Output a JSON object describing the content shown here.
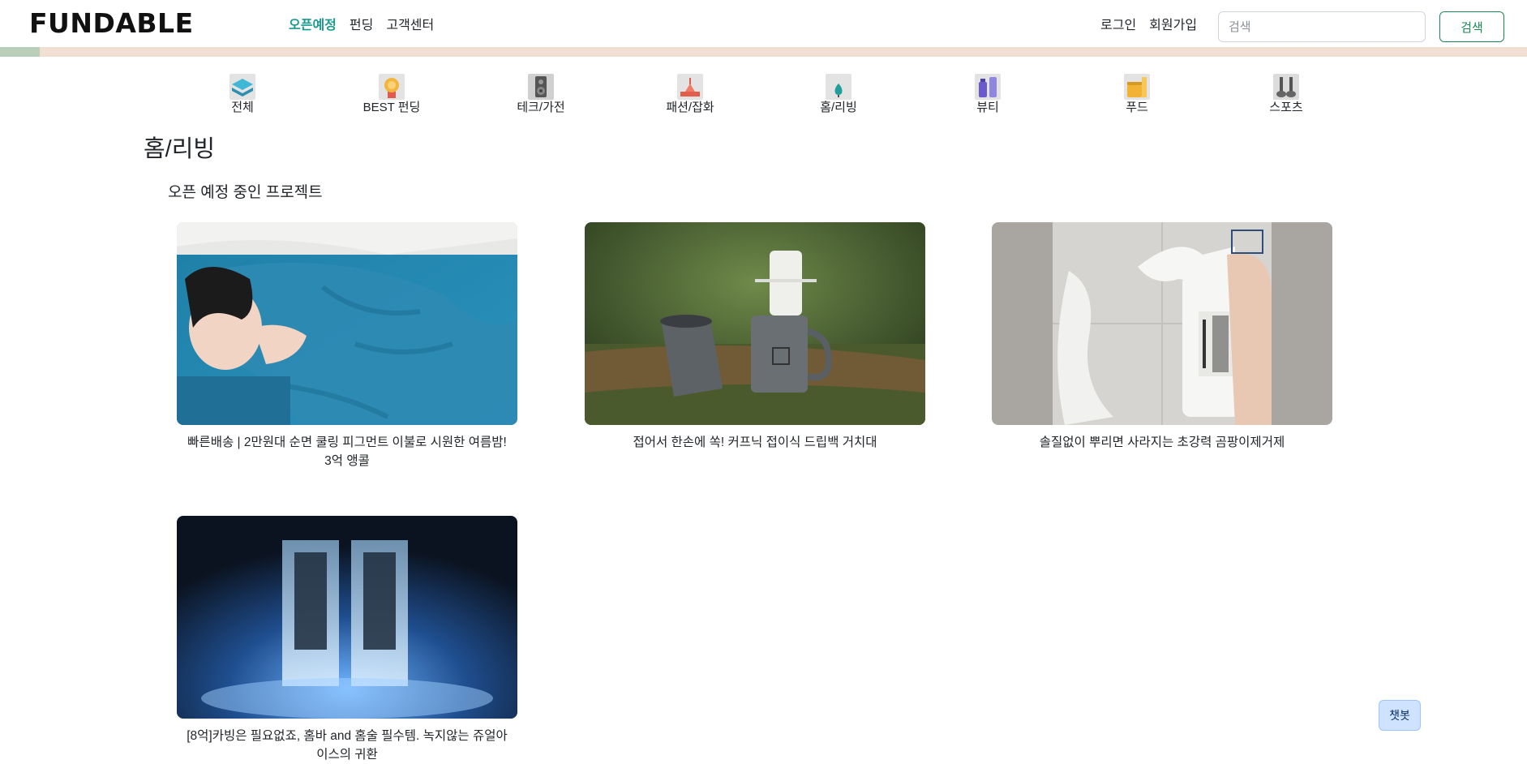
{
  "navbar": {
    "logo": "FUNDABLE",
    "links": [
      {
        "label": "오픈예정",
        "active": true
      },
      {
        "label": "펀딩",
        "active": false
      },
      {
        "label": "고객센터",
        "active": false
      }
    ],
    "login": "로그인",
    "signup": "회원가입",
    "search_placeholder": "검색",
    "search_value": "",
    "search_button": "검색"
  },
  "progress": {
    "fraction": 0.026,
    "fill_color": "#b9cfba",
    "track_color": "#f1dfd3"
  },
  "categories": [
    {
      "label": "전체",
      "icon": "layers-icon"
    },
    {
      "label": "BEST 펀딩",
      "icon": "medal-icon"
    },
    {
      "label": "테크/가전",
      "icon": "speaker-icon"
    },
    {
      "label": "패션/잡화",
      "icon": "fashion-icon"
    },
    {
      "label": "홈/리빙",
      "icon": "plant-icon"
    },
    {
      "label": "뷰티",
      "icon": "cosmetics-icon"
    },
    {
      "label": "푸드",
      "icon": "food-icon"
    },
    {
      "label": "스포츠",
      "icon": "sports-icon"
    }
  ],
  "page_title": "홈/리빙",
  "section_title": "오픈 예정 중인 프로젝트",
  "projects": [
    {
      "title": "빠른배송 | 2만원대 순면 쿨링 피그먼트 이불로 시원한 여름밤! 3억 앵콜",
      "image": "blue-blanket-photo"
    },
    {
      "title": "접어서 한손에 쏙! 커프닉 접이식 드립백 거치대",
      "image": "coffee-dripper-photo"
    },
    {
      "title": "솔질없이 뿌리면 사라지는 초강력 곰팡이제거제",
      "image": "mold-remover-spray-photo"
    },
    {
      "title": "[8억]카빙은 필요없죠, 홈바 and 홈술 필수템. 녹지않는 쥬얼아이스의 귀환",
      "image": "ice-cubes-photo"
    }
  ],
  "chatbot_label": "챗봇",
  "colors": {
    "accent": "#1a9a8f",
    "success": "#198754",
    "chatbot_bg": "#cfe2ff"
  }
}
